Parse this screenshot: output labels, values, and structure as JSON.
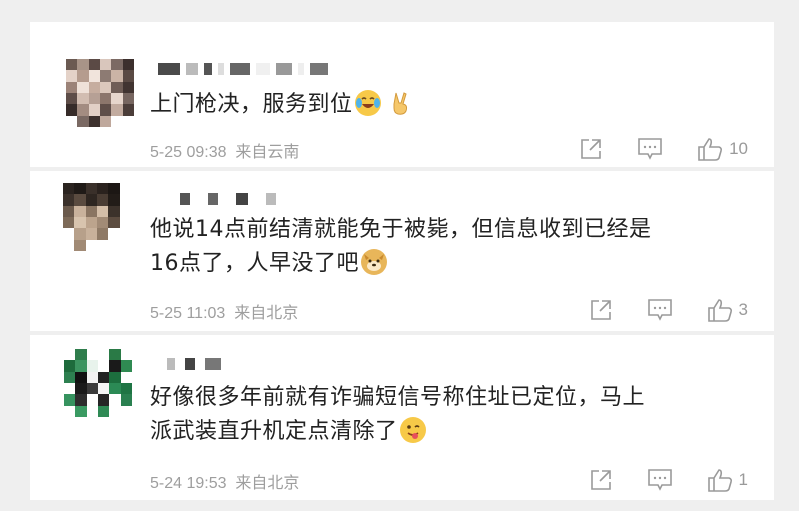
{
  "comments": [
    {
      "text": "上门枪决，服务到位",
      "time": "5-25 09:38",
      "location": "来自云南",
      "likes": "10",
      "emojis": [
        "crying-laughing-emoji",
        "victory-hand-emoji"
      ]
    },
    {
      "text_line1": "他说14点前结清就能免于被毙，但信息收到已经是",
      "text_line2": "16点了，人早没了吧",
      "time": "5-25 11:03",
      "location": "来自北京",
      "likes": "3",
      "emojis": [
        "doge-emoji"
      ]
    },
    {
      "text_line1": "好像很多年前就有诈骗短信号称住址已定位，马上",
      "text_line2": "派武装直升机定点清除了",
      "time": "5-24 19:53",
      "location": "来自北京",
      "likes": "1",
      "emojis": [
        "tongue-face-emoji"
      ]
    }
  ],
  "colors": {
    "background": "#efefef",
    "card": "#ffffff",
    "text": "#222222",
    "meta": "#9e9e9e",
    "icon": "#9a9a9a"
  }
}
